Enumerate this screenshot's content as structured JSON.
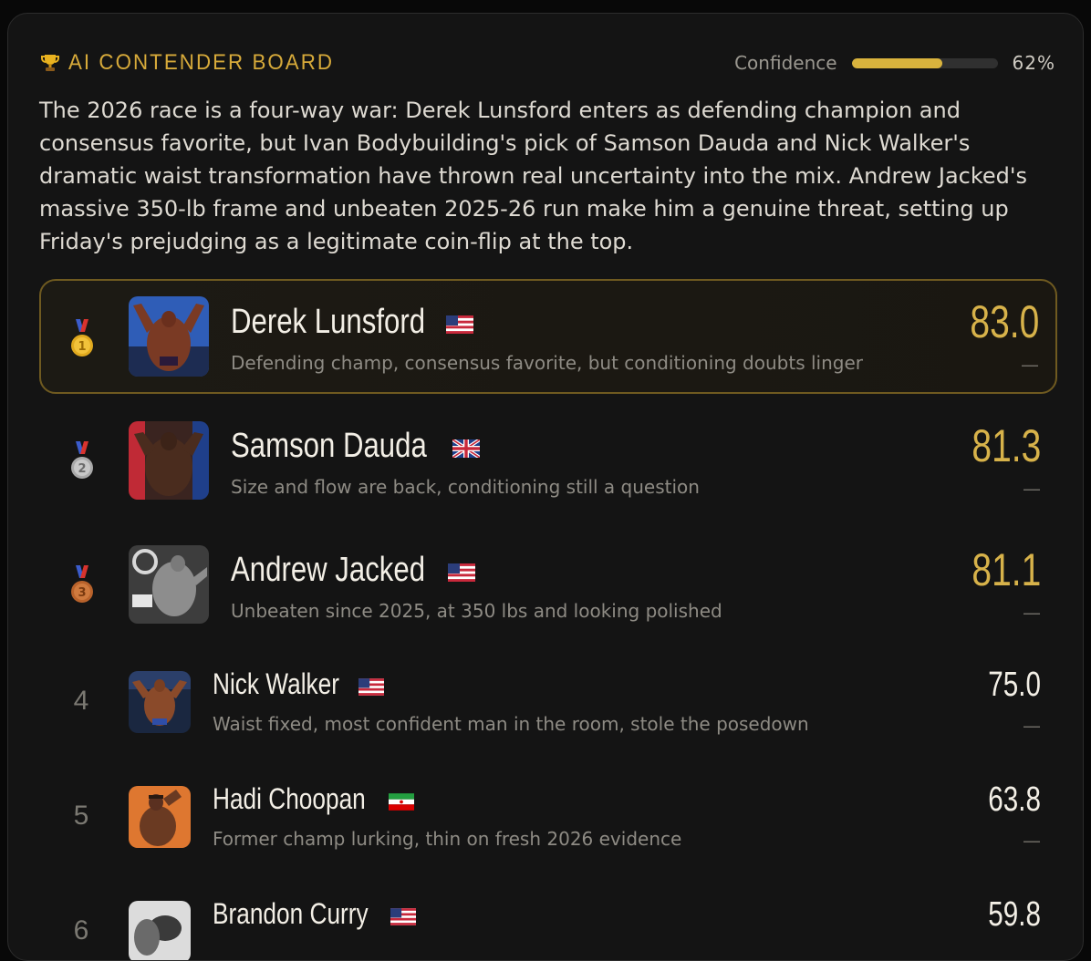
{
  "board": {
    "title": "AI CONTENDER BOARD",
    "confidence_label": "Confidence",
    "confidence_value": 0.62,
    "confidence_text": "62%",
    "summary": "The 2026 race is a four-way war: Derek Lunsford enters as defending champion and consensus favorite, but Ivan Bodybuilding's pick of Samson Dauda and Nick Walker's dramatic waist transformation have thrown real uncertainty into the mix. Andrew Jacked's massive 350-lb frame and unbeaten 2025-26 run make him a genuine threat, setting up Friday's prejudging as a legitimate coin-flip at the top."
  },
  "contenders": [
    {
      "rank": "1",
      "name": "Derek Lunsford",
      "flag": "us-flag-icon",
      "desc": "Defending champ, consensus favorite, but conditioning doubts linger",
      "score": "83.0",
      "delta": "—"
    },
    {
      "rank": "2",
      "name": "Samson Dauda",
      "flag": "uk-flag-icon",
      "desc": "Size and flow are back, conditioning still a question",
      "score": "81.3",
      "delta": "—"
    },
    {
      "rank": "3",
      "name": "Andrew Jacked",
      "flag": "us-flag-icon",
      "desc": "Unbeaten since 2025, at 350 lbs and looking polished",
      "score": "81.1",
      "delta": "—"
    },
    {
      "rank": "4",
      "name": "Nick Walker",
      "flag": "us-flag-icon",
      "desc": "Waist fixed, most confident man in the room, stole the posedown",
      "score": "75.0",
      "delta": "—"
    },
    {
      "rank": "5",
      "name": "Hadi Choopan",
      "flag": "iran-flag-icon",
      "desc": "Former champ lurking, thin on fresh 2026 evidence",
      "score": "63.8",
      "delta": "—"
    },
    {
      "rank": "6",
      "name": "Brandon Curry",
      "flag": "us-flag-icon",
      "desc": "",
      "score": "59.8",
      "delta": ""
    }
  ],
  "colors": {
    "accent": "#d7b24a",
    "background": "#141414",
    "gold_medal": "#e0a91e",
    "silver_medal": "#a9a9a9",
    "bronze_medal": "#b8622b"
  }
}
